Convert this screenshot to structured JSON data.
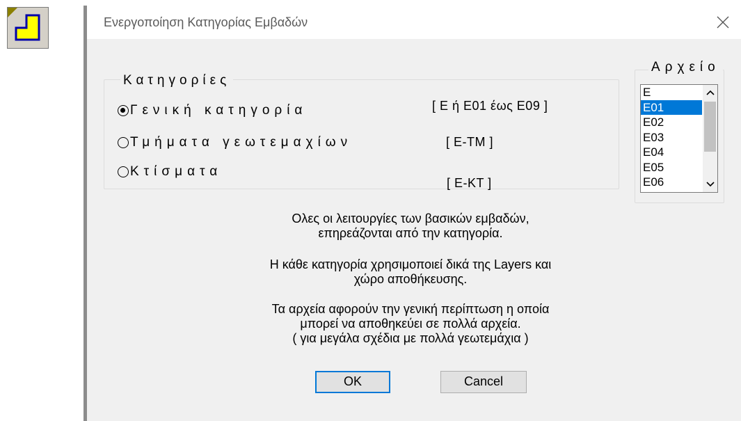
{
  "dialog": {
    "title": "Ενεργοποίηση Κατηγορίας Εμβαδών"
  },
  "categories": {
    "legend": "Κατηγορίες",
    "options": [
      {
        "label": "Γενική κατηγορία",
        "code": "[ Ε ή Ε01 έως Ε09 ]",
        "checked": true
      },
      {
        "label": "Τμήματα γεωτεμαχίων",
        "code": "[ Ε-ΤΜ ]",
        "checked": false
      },
      {
        "label": "Κτίσματα",
        "code": "[ Ε-ΚΤ ]",
        "checked": false
      }
    ]
  },
  "files": {
    "legend": "Αρχείο",
    "items": [
      "Ε",
      "Ε01",
      "Ε02",
      "Ε03",
      "Ε04",
      "Ε05",
      "Ε06"
    ],
    "selected": "Ε01"
  },
  "info": {
    "p1_line1": "Ολες οι λειτουργίες των βασικών εμβαδών,",
    "p1_line2": "επηρεάζονται από την κατηγορία.",
    "p2_line1": "Η κάθε κατηγορία χρησιμοποιεί δικά της Layers και",
    "p2_line2": "χώρο αποθήκευσης.",
    "p3_line1": "Τα αρχεία αφορούν την γενική περίπτωση η οποία",
    "p3_line2": "μπορεί να αποθηκεύει σε πολλά αρχεία.",
    "p3_line3": "( για μεγάλα σχέδια με πολλά γεωτεμάχια )"
  },
  "buttons": {
    "ok": "OK",
    "cancel": "Cancel"
  },
  "colors": {
    "selection": "#0078d7",
    "icon_fill": "#ffff00",
    "icon_corner": "#8b8000"
  },
  "icons": {
    "app": "app-area-icon",
    "close": "close-icon",
    "scroll_up": "chevron-up-icon",
    "scroll_down": "chevron-down-icon"
  }
}
